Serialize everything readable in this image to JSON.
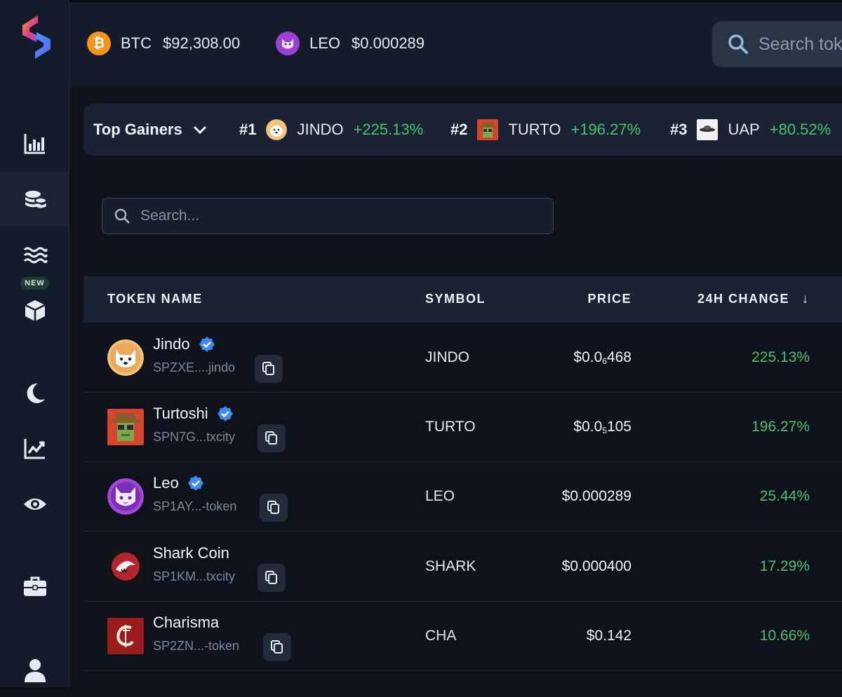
{
  "ticker": [
    {
      "symbol": "BTC",
      "price": "$92,308.00",
      "icon": "bitcoin-icon",
      "color": "#f5931a"
    },
    {
      "symbol": "LEO",
      "price": "$0.000289",
      "icon": "leo-cat-icon",
      "color": "#9b3fd6"
    }
  ],
  "top_search": {
    "placeholder": "Search tok"
  },
  "gainers": {
    "title": "Top Gainers",
    "items": [
      {
        "rank": "#1",
        "symbol": "JINDO",
        "change": "+225.13%"
      },
      {
        "rank": "#2",
        "symbol": "TURTO",
        "change": "+196.27%"
      },
      {
        "rank": "#3",
        "symbol": "UAP",
        "change": "+80.52%"
      }
    ]
  },
  "sidebar": {
    "new_badge": "NEW"
  },
  "search": {
    "placeholder": "Search..."
  },
  "table": {
    "headers": {
      "name": "TOKEN NAME",
      "symbol": "SYMBOL",
      "price": "PRICE",
      "change": "24H CHANGE"
    },
    "sort_arrow": "↓",
    "rows": [
      {
        "name": "Jindo",
        "address": "SPZXE....jindo",
        "symbol": "JINDO",
        "price_main": "$0.0",
        "price_sub": "6",
        "price_rest": "468",
        "change": "225.13%",
        "verified": true
      },
      {
        "name": "Turtoshi",
        "address": "SPN7G...txcity",
        "symbol": "TURTO",
        "price_main": "$0.0",
        "price_sub": "5",
        "price_rest": "105",
        "change": "196.27%",
        "verified": true
      },
      {
        "name": "Leo",
        "address": "SP1AY...-token",
        "symbol": "LEO",
        "price_main": "$0.000289",
        "price_sub": "",
        "price_rest": "",
        "change": "25.44%",
        "verified": true
      },
      {
        "name": "Shark Coin",
        "address": "SP1KM...txcity",
        "symbol": "SHARK",
        "price_main": "$0.000400",
        "price_sub": "",
        "price_rest": "",
        "change": "17.29%",
        "verified": false
      },
      {
        "name": "Charisma",
        "address": "SP2ZN...-token",
        "symbol": "CHA",
        "price_main": "$0.142",
        "price_sub": "",
        "price_rest": "",
        "change": "10.66%",
        "verified": false
      }
    ]
  },
  "colors": {
    "positive": "#4bc16d",
    "verified": "#3b8cf0",
    "background": "#0d121b"
  }
}
